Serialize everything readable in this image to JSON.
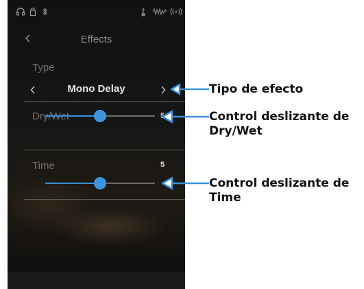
{
  "header": {
    "title": "Effects"
  },
  "type_section": {
    "label": "Type",
    "value": "Mono Delay"
  },
  "sliders": [
    {
      "label": "Dry/Wet",
      "value": "5",
      "level": 0.5
    },
    {
      "label": "Time",
      "value": "5",
      "level": 0.5
    }
  ],
  "annotations": {
    "type": "Tipo de efecto",
    "drywet_line1": "Control deslizante de",
    "drywet_line2": "Dry/Wet",
    "time_line1": "Control deslizante de",
    "time_line2": "Time"
  },
  "colors": {
    "accent": "#3f94dc",
    "background": "#141414",
    "annotation": "#3a8fd9"
  }
}
